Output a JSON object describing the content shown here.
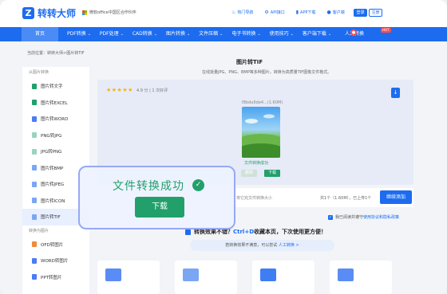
{
  "header": {
    "logo_text": "转转大师",
    "partner_text": "微软office中国区合作伙伴",
    "links": [
      {
        "icon": "fire-icon",
        "label": "热门导航"
      },
      {
        "icon": "api-icon",
        "label": "API接口"
      },
      {
        "icon": "app-icon",
        "label": "APP下载"
      },
      {
        "icon": "customer-service-icon",
        "label": "客户端"
      }
    ],
    "login_label": "登录",
    "register_label": "注册"
  },
  "nav": {
    "home": "首页",
    "items": [
      "PDF转换",
      "PDF处理",
      "CAD转换",
      "图片转换",
      "文件压缩",
      "电子书转换",
      "使用技巧",
      "客户端下载",
      "人工转换"
    ],
    "hot_badge": "HOT"
  },
  "breadcrumb": "当前位置：转转大师>图片转TIF",
  "sidebar": {
    "group1": "从图片转换",
    "items1": [
      "图片转文字",
      "图片转EXCEL",
      "图片转WORD",
      "PNG转JPG",
      "JPG转PNG",
      "图片转BMP",
      "图片转JPEG",
      "图片转ICON",
      "图片转TIF"
    ],
    "group2": "转换为图片",
    "items2": [
      "OFD转图片",
      "WORD转图片",
      "PPT转图片"
    ]
  },
  "main": {
    "title": "图片转TIF",
    "subtitle": "在线批量JPG、PNG、BMP等多种图片，转换为高质量TIF图像文件格式。",
    "stars": "★★★★★",
    "rating": "4.9 分 | 1 次好评",
    "file_name": "f8bdu6de4...(1.60M)",
    "file_status": "文件转换成功",
    "delete_label": "删除",
    "download_label": "下载",
    "toolbar_note": "将它完文件转换大小",
    "file_count": "共1个（1.60M），已上传1个",
    "convert_button": "继续添加",
    "agree_text": "我已阅读并遵守",
    "agree_link": "使用协议和隐私政策",
    "feedback_prefix": "转换效果不错？",
    "feedback_hotkey": "Ctrl+D",
    "feedback_suffix": "收藏本页，下次使用更方便！",
    "suggest_text": "若转换效果不满意，可以尝试",
    "suggest_link": "人工转换 >"
  },
  "popup": {
    "title": "文件转换成功",
    "button": "下载"
  },
  "colors": {
    "brand": "#1d6cf0",
    "success": "#22a06b",
    "hot": "#ff4d4f"
  }
}
